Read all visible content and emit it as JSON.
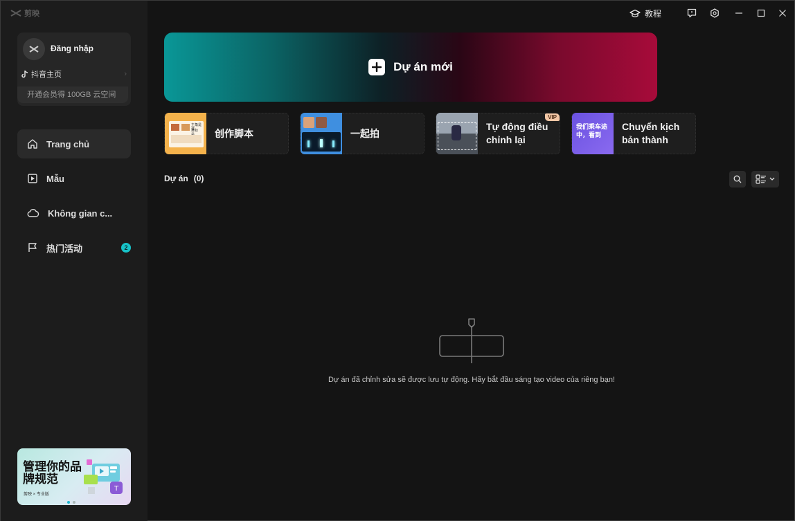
{
  "app": {
    "logo_text": "剪映"
  },
  "window_controls": {
    "tutorial_label": "教程"
  },
  "account": {
    "login_label": "Đăng nhập",
    "douyin_label": "抖音主页",
    "vip_promo": "开通会员得 100GB 云空间"
  },
  "sidebar": {
    "items": [
      {
        "label": "Trang chủ",
        "icon": "home-icon",
        "active": true
      },
      {
        "label": "Mẫu",
        "icon": "template-icon",
        "active": false
      },
      {
        "label": "Không gian c...",
        "icon": "cloud-icon",
        "active": false
      },
      {
        "label": "热门活动",
        "icon": "flag-icon",
        "active": false,
        "badge": "2"
      }
    ]
  },
  "banner": {
    "title": "管理你的品牌规范",
    "subtitle": "剪映 × 专业版"
  },
  "hero": {
    "label": "Dự án mới"
  },
  "tools": [
    {
      "label": "创作脚本",
      "thumb_text_1": "主角是谁",
      "thumb_text_2": "目标是...",
      "vip": false
    },
    {
      "label": "一起拍",
      "vip": false
    },
    {
      "label": "Tự động điều chỉnh lại",
      "vip": true,
      "vip_label": "VIP"
    },
    {
      "label": "Chuyển kịch bản thành",
      "thumb_text": "我们乘车途中，看到",
      "vip": false
    }
  ],
  "projects": {
    "title": "Dự án",
    "count": "(0)",
    "empty_message": "Dự án đã chỉnh sửa sẽ được lưu tự động. Hãy bắt đầu sáng tạo video của riêng bạn!"
  },
  "colors": {
    "accent": "#17c3c9",
    "hero_left": "#0a9797",
    "hero_right": "#a70b3a",
    "vip_badge": "#f3c7a6"
  }
}
